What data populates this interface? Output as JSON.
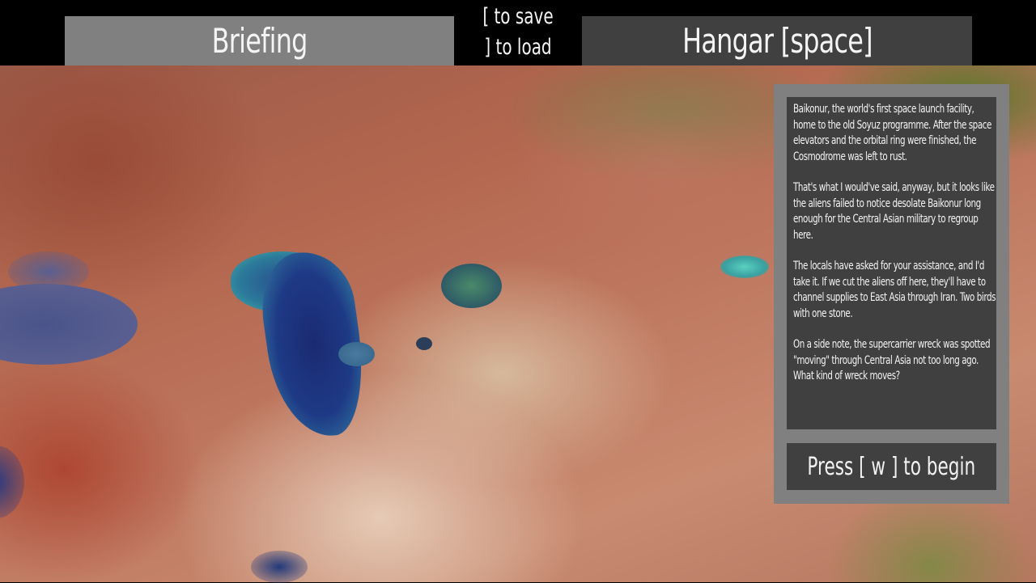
{
  "header": {
    "briefing_tab": "Briefing",
    "save_hint": "[ to save",
    "load_hint": "] to load",
    "hangar_tab": "Hangar [space]"
  },
  "briefing": {
    "paragraphs": [
      "Baikonur, the world's first space launch facility, home to the old Soyuz programme. After the space elevators and the orbital ring were finished, the Cosmodrome was left to rust.",
      "That's what I would've said, anyway, but it looks like the aliens failed to notice desolate Baikonur long enough for the Central Asian military to regroup here.",
      "The locals have asked for your assistance, and I'd take it. If we cut the aliens off here, they'll have to channel supplies to East Asia through Iran. Two birds with one stone.",
      "On a side note, the supercarrier wreck was spotted \"moving\" through Central Asia not too long ago. What kind of wreck moves?"
    ],
    "begin_label": "Press [ w ] to begin"
  },
  "colors": {
    "active_tab": "#808080",
    "inactive_tab": "#404040",
    "panel_frame": "#808080",
    "panel_body": "#404040",
    "text": "#f2f2f2"
  }
}
